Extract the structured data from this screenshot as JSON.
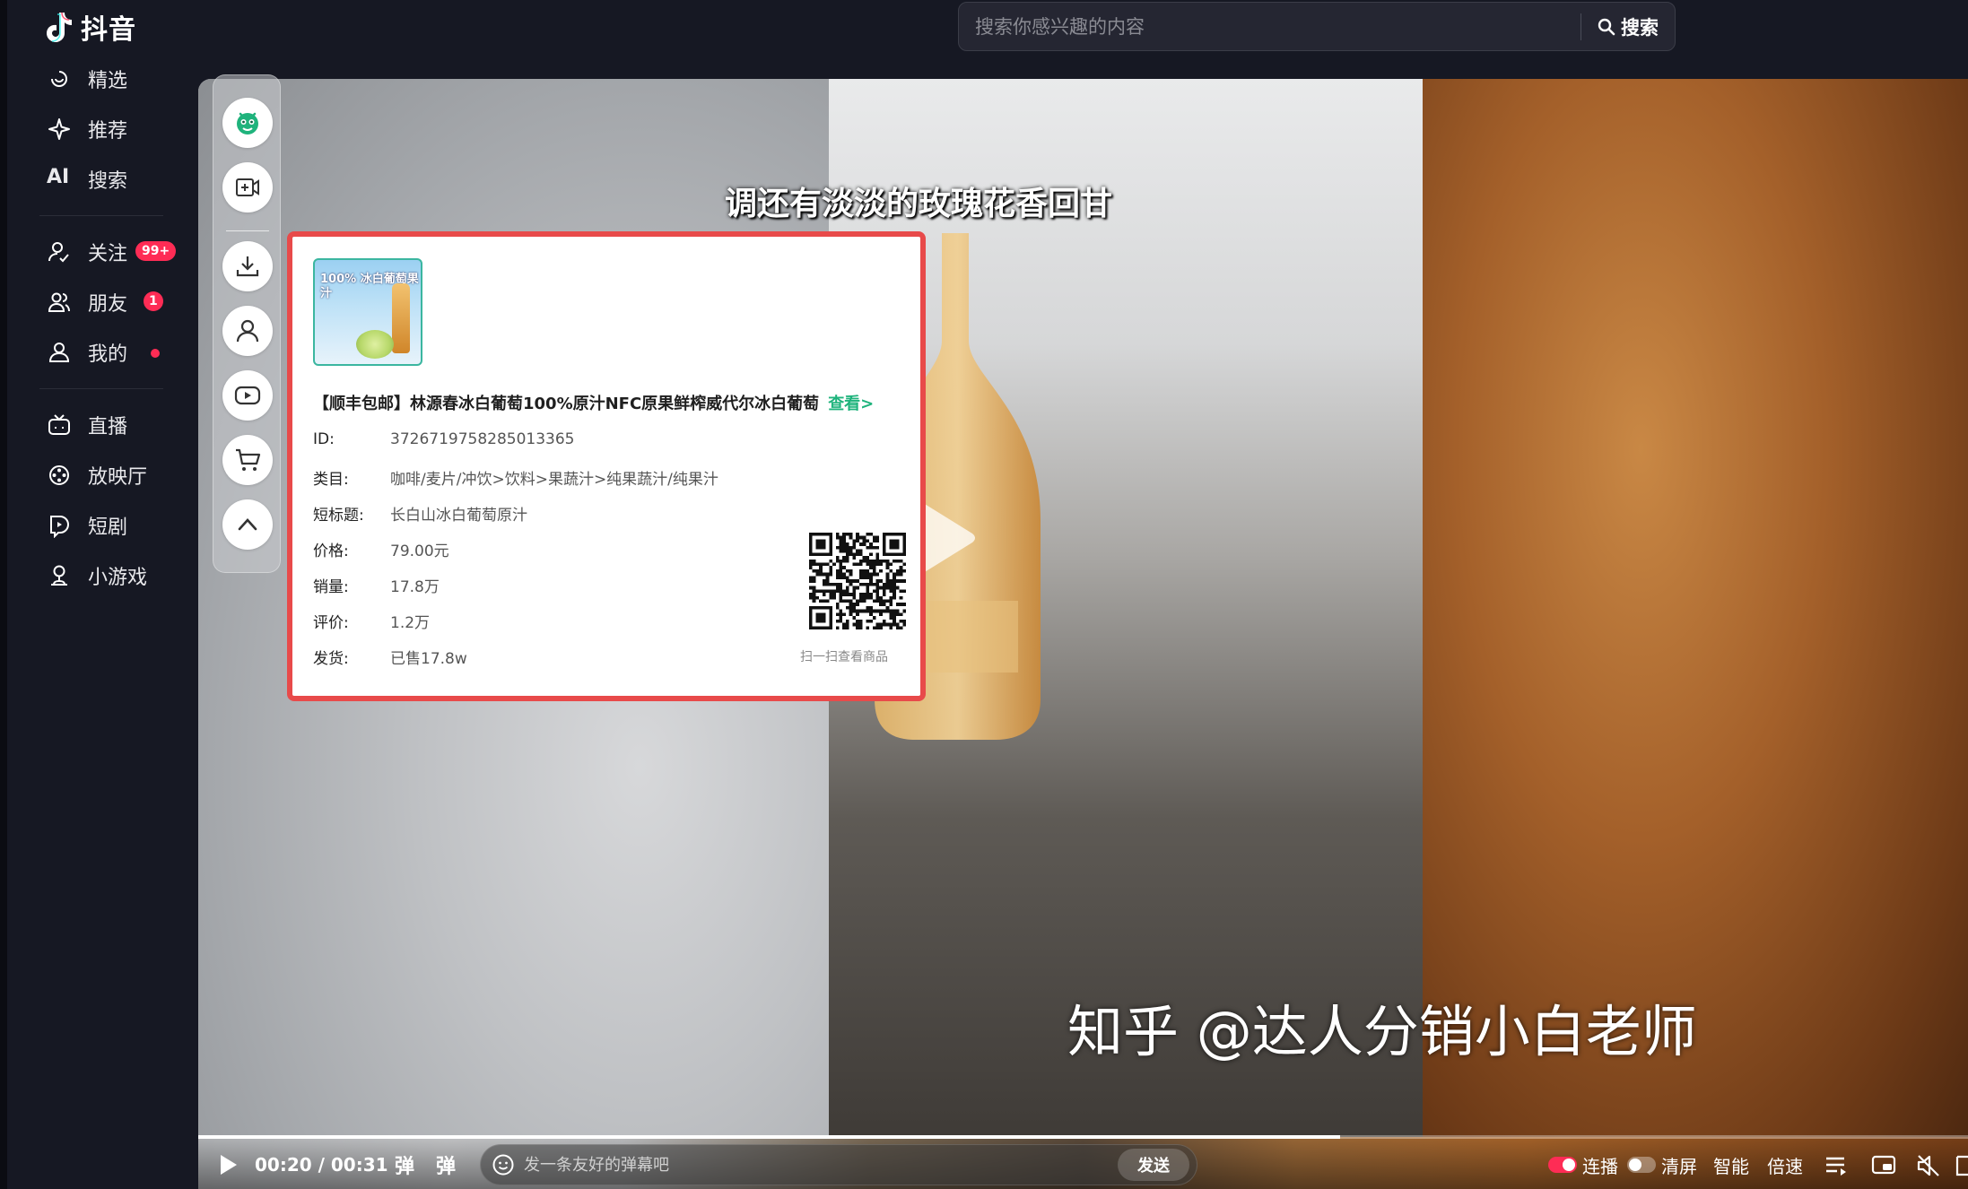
{
  "app": {
    "name": "抖音"
  },
  "search": {
    "placeholder": "搜索你感兴趣的内容",
    "button_label": "搜索"
  },
  "sidebar": {
    "items": [
      {
        "label": "精选",
        "icon": "featured-icon"
      },
      {
        "label": "推荐",
        "icon": "sparkle-icon"
      },
      {
        "label": "搜索",
        "icon": "ai-icon"
      },
      {
        "label": "关注",
        "icon": "follow-icon",
        "badge": "99+"
      },
      {
        "label": "朋友",
        "icon": "friends-icon",
        "badge": "1"
      },
      {
        "label": "我的",
        "icon": "user-icon",
        "dot": true
      },
      {
        "label": "直播",
        "icon": "tv-icon"
      },
      {
        "label": "放映厅",
        "icon": "film-icon"
      },
      {
        "label": "短剧",
        "icon": "short-drama-icon"
      },
      {
        "label": "小游戏",
        "icon": "game-icon"
      }
    ],
    "ai_prefix": "AI"
  },
  "video": {
    "subtitle": "调还有淡淡的玫瑰花香回甘",
    "watermark": "知乎 @达人分销小白老师"
  },
  "product": {
    "title": "【顺丰包邮】林源春冰白葡萄100%原汁NFC原果鲜榨威代尔冰白葡萄",
    "view_link": "查看>",
    "thumb_text": "100% 冰白葡萄果汁",
    "fields": [
      {
        "key": "ID:",
        "value": "3726719758285013365"
      },
      {
        "key": "类目:",
        "value": "咖啡/麦片/冲饮>饮料>果蔬汁>纯果蔬汁/纯果汁"
      },
      {
        "key": "短标题:",
        "value": "长白山冰白葡萄原汁"
      },
      {
        "key": "价格:",
        "value": "79.00元"
      },
      {
        "key": "销量:",
        "value": "17.8万"
      },
      {
        "key": "评价:",
        "value": "1.2万"
      },
      {
        "key": "发货:",
        "value": "已售17.8w"
      }
    ],
    "qr_caption": "扫一扫查看商品"
  },
  "player": {
    "time": "00:20 / 00:31",
    "progress_fraction": 0.645,
    "danmu_on_label": "弹",
    "danmu_settings_label": "弹",
    "danmu_placeholder": "发一条友好的弹幕吧",
    "send_label": "发送",
    "autoplay_label": "连播",
    "clear_label": "清屏",
    "smart_label": "智能",
    "speed_label": "倍速"
  },
  "colors": {
    "accent": "#fe2c55",
    "link_green": "#1fb37c",
    "highlight_border": "#e84a4a"
  }
}
